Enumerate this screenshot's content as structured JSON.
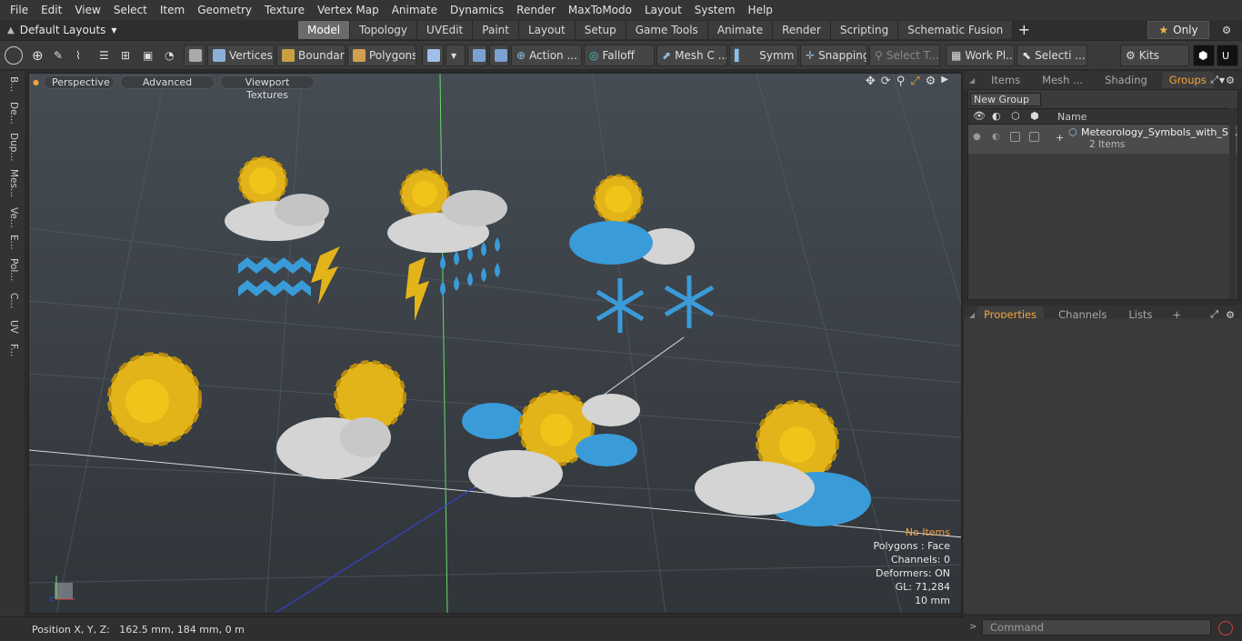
{
  "menu": [
    "File",
    "Edit",
    "View",
    "Select",
    "Item",
    "Geometry",
    "Texture",
    "Vertex Map",
    "Animate",
    "Dynamics",
    "Render",
    "MaxToModo",
    "Layout",
    "System",
    "Help"
  ],
  "layouts_label": "Default Layouts",
  "tabs": [
    "Model",
    "Topology",
    "UVEdit",
    "Paint",
    "Layout",
    "Setup",
    "Game Tools",
    "Animate",
    "Render",
    "Scripting",
    "Schematic Fusion"
  ],
  "active_tab": "Model",
  "only_label": "Only",
  "toolbar": {
    "vertices": "Vertices",
    "boundary": "Boundary",
    "polygons": "Polygons",
    "action": "Action ...",
    "falloff": "Falloff",
    "mesh": "Mesh C ...",
    "symm": "Symm ...",
    "snapping": "Snapping",
    "select_t": "Select T...",
    "work_pl": "Work Pl...",
    "selecti": "Selecti ...",
    "kits": "Kits"
  },
  "left_tabs": [
    "B...",
    "De...",
    "Dup...",
    "Mes...",
    "Ve...",
    "E...",
    "Pol...",
    "C...",
    "UV",
    "F..."
  ],
  "viewport": {
    "perspective": "Perspective",
    "advanced": "Advanced",
    "textures": "Viewport Textures",
    "info": {
      "items": "No Items",
      "polygons": "Polygons : Face",
      "channels": "Channels: 0",
      "deformers": "Deformers: ON",
      "gl": "GL: 71,284",
      "scale": "10 mm"
    }
  },
  "status": "Position X, Y, Z:   162.5 mm, 184 mm, 0 m",
  "right_tabs": [
    "Items",
    "Mesh ...",
    "Shading",
    "Groups"
  ],
  "right_active": "Groups",
  "new_group": "New Group",
  "groups_col_name": "Name",
  "group_item": {
    "name": "Meteorology_Symbols_with_S...",
    "count": "2 Items"
  },
  "prop_tabs": [
    "Properties",
    "Channels",
    "Lists"
  ],
  "prop_active": "Properties",
  "command_placeholder": "Command",
  "colors": {
    "accent": "#f0a33c",
    "sun": "#f0c419",
    "cloud_white": "#d9d9d9",
    "cloud_blue": "#3a9bd9",
    "viewport_top": "#454c53"
  }
}
